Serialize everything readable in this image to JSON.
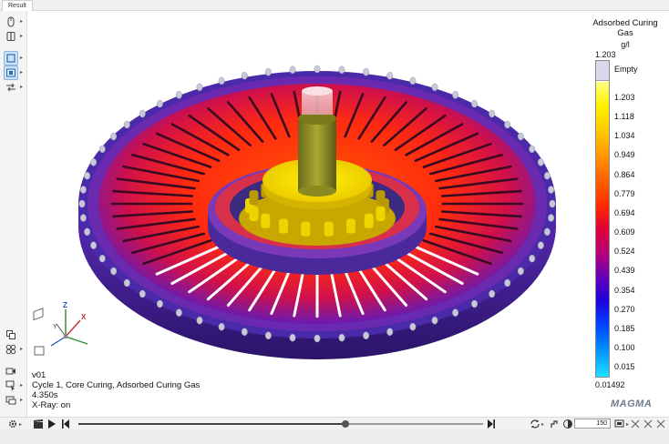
{
  "tabs": [
    {
      "label": "Result",
      "active": true
    }
  ],
  "left_toolbar": {
    "items": [
      {
        "icon": "mouse-icon",
        "has_dropdown": true,
        "active": false
      },
      {
        "icon": "clipping-plane-icon",
        "has_dropdown": true,
        "active": false
      },
      {
        "icon": "view-frame-icon",
        "has_dropdown": true,
        "active": true
      },
      {
        "icon": "view-selection-icon",
        "has_dropdown": true,
        "active": true
      },
      {
        "icon": "transfer-arrows-icon",
        "has_dropdown": true,
        "active": false
      },
      {
        "icon": "layers-icon",
        "has_dropdown": false,
        "active": false
      },
      {
        "icon": "grid-nodes-icon",
        "has_dropdown": true,
        "active": false
      },
      {
        "icon": "camera-icon",
        "has_dropdown": false,
        "active": false
      },
      {
        "icon": "pointer-select-icon",
        "has_dropdown": true,
        "active": false
      },
      {
        "icon": "overlay-windows-icon",
        "has_dropdown": true,
        "active": false
      }
    ]
  },
  "viewport": {
    "info_lines": [
      "v01",
      "Cycle 1, Core Curing, Adsorbed Curing Gas",
      "4.350s",
      "X-Ray: on"
    ],
    "axes": {
      "x_label": "X",
      "y_label": "Y",
      "z_label": "Z"
    }
  },
  "legend": {
    "title": "Adsorbed Curing Gas",
    "unit": "g/l",
    "max_value": "1.203",
    "empty_label": "Empty",
    "ticks": [
      "1.203",
      "1.118",
      "1.034",
      "0.949",
      "0.864",
      "0.779",
      "0.694",
      "0.609",
      "0.524",
      "0.439",
      "0.354",
      "0.270",
      "0.185",
      "0.100",
      "0.015"
    ],
    "min_value": "0.01492"
  },
  "logo_text": "MAGMA",
  "playback": {
    "timeline_progress": 0.66,
    "speed_value": "150",
    "icons": [
      "settings-icon",
      "clapperboard-icon",
      "play-icon",
      "skip-to-start-icon",
      "skip-to-end-icon",
      "loop-icon",
      "step-icon",
      "contrast-icon",
      "video-icon",
      "close-icon"
    ]
  },
  "colors": {
    "hot": "#ff2a00",
    "core": "#f4f000",
    "cold": "#2000d8",
    "empty": "#dcd6ee"
  }
}
